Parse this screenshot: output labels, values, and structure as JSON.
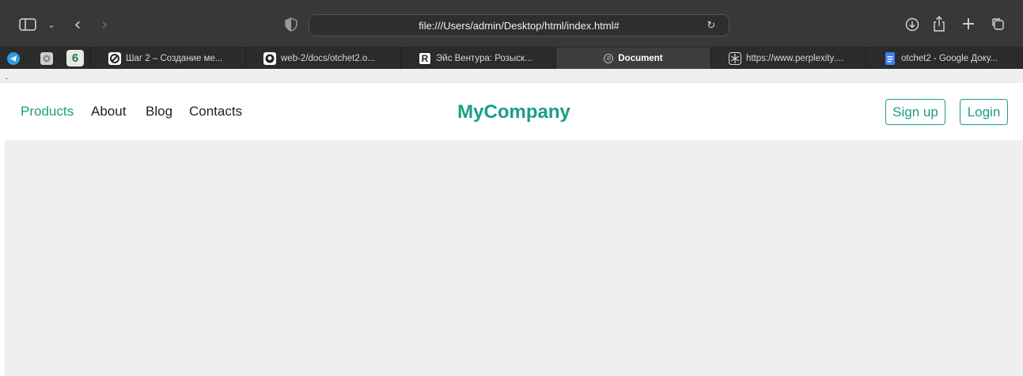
{
  "browser": {
    "address": "file:///Users/admin/Desktop/html/index.html#",
    "icons": {
      "sidebar": "sidebar-icon",
      "chevron": "chevron-down-icon",
      "back": "back-icon",
      "forward": "forward-icon",
      "privacy": "shield-icon",
      "reload": "reload-icon",
      "download": "download-icon",
      "share": "share-icon",
      "new_tab": "plus-icon",
      "tab_overview": "tab-overview-icon"
    },
    "tabs": [
      {
        "label": "Шаг 2 – Создание ме...",
        "icon": "ubiquiti-icon"
      },
      {
        "label": "web-2/docs/otchet2.o...",
        "icon": "github-icon"
      },
      {
        "label": "Эйс Вентура: Розыск...",
        "icon": "r-icon"
      },
      {
        "label": "Document",
        "icon": "compass-icon",
        "active": true
      },
      {
        "label": "https://www.perplexity....",
        "icon": "perplexity-icon"
      },
      {
        "label": "otchet2 - Google Доку...",
        "icon": "docs-icon"
      }
    ],
    "pinned": [
      "telegram-icon",
      "settings-app-icon",
      "six-icon"
    ],
    "pinned_glyph": "6"
  },
  "page": {
    "top_text": ".",
    "nav": [
      "Products",
      "About",
      "Blog",
      "Contacts"
    ],
    "brand": "MyCompany",
    "signup": "Sign up",
    "login": "Login"
  },
  "colors": {
    "accent": "#1a9e86",
    "content_bg": "#efefef",
    "toolbar_bg": "#383838"
  }
}
